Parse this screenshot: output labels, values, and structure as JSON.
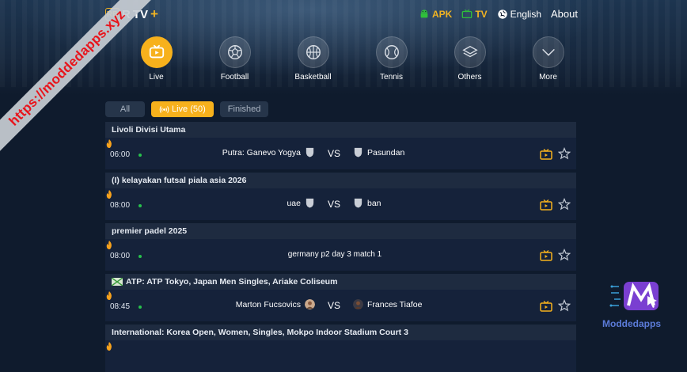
{
  "brand": {
    "badge": "RB",
    "name": "R",
    "name_suffix": "TV",
    "plus": "+"
  },
  "toplinks": {
    "apk": "APK",
    "tv": "TV",
    "language": "English",
    "about": "About"
  },
  "categories": [
    {
      "label": "Live",
      "icon": "live-tv-icon",
      "active": true
    },
    {
      "label": "Football",
      "icon": "football-icon"
    },
    {
      "label": "Basketball",
      "icon": "basketball-icon"
    },
    {
      "label": "Tennis",
      "icon": "tennis-icon"
    },
    {
      "label": "Others",
      "icon": "layers-icon"
    },
    {
      "label": "More",
      "icon": "chevron-down-icon"
    }
  ],
  "filters": {
    "all": "All",
    "live": "Live (50)",
    "finished": "Finished"
  },
  "leagues": [
    {
      "title": "Livoli Divisi Utama",
      "match": {
        "time": "06:00",
        "home": "Putra: Ganevo Yogya",
        "vs": "VS",
        "away": "Pasundan"
      }
    },
    {
      "title": "(I) kelayakan futsal piala asia 2026",
      "match": {
        "time": "08:00",
        "home": "uae",
        "vs": "VS",
        "away": "ban"
      }
    },
    {
      "title": "premier padel 2025",
      "match": {
        "time": "08:00",
        "event": "germany p2 day 3 match 1"
      }
    },
    {
      "title": "ATP: ATP Tokyo, Japan Men Singles, Ariake Coliseum",
      "match": {
        "time": "08:45",
        "home": "Marton Fucsovics",
        "vs": "VS",
        "away": "Frances Tiafoe"
      }
    },
    {
      "title": "International: Korea Open, Women, Singles, Mokpo Indoor Stadium Court 3"
    }
  ],
  "watermark": {
    "url": "https://moddedapps.xyz",
    "brand": "Moddedapps"
  },
  "colors": {
    "accent": "#f7b11c",
    "live_dot": "#27c24c",
    "background": "#0f1b2d"
  }
}
